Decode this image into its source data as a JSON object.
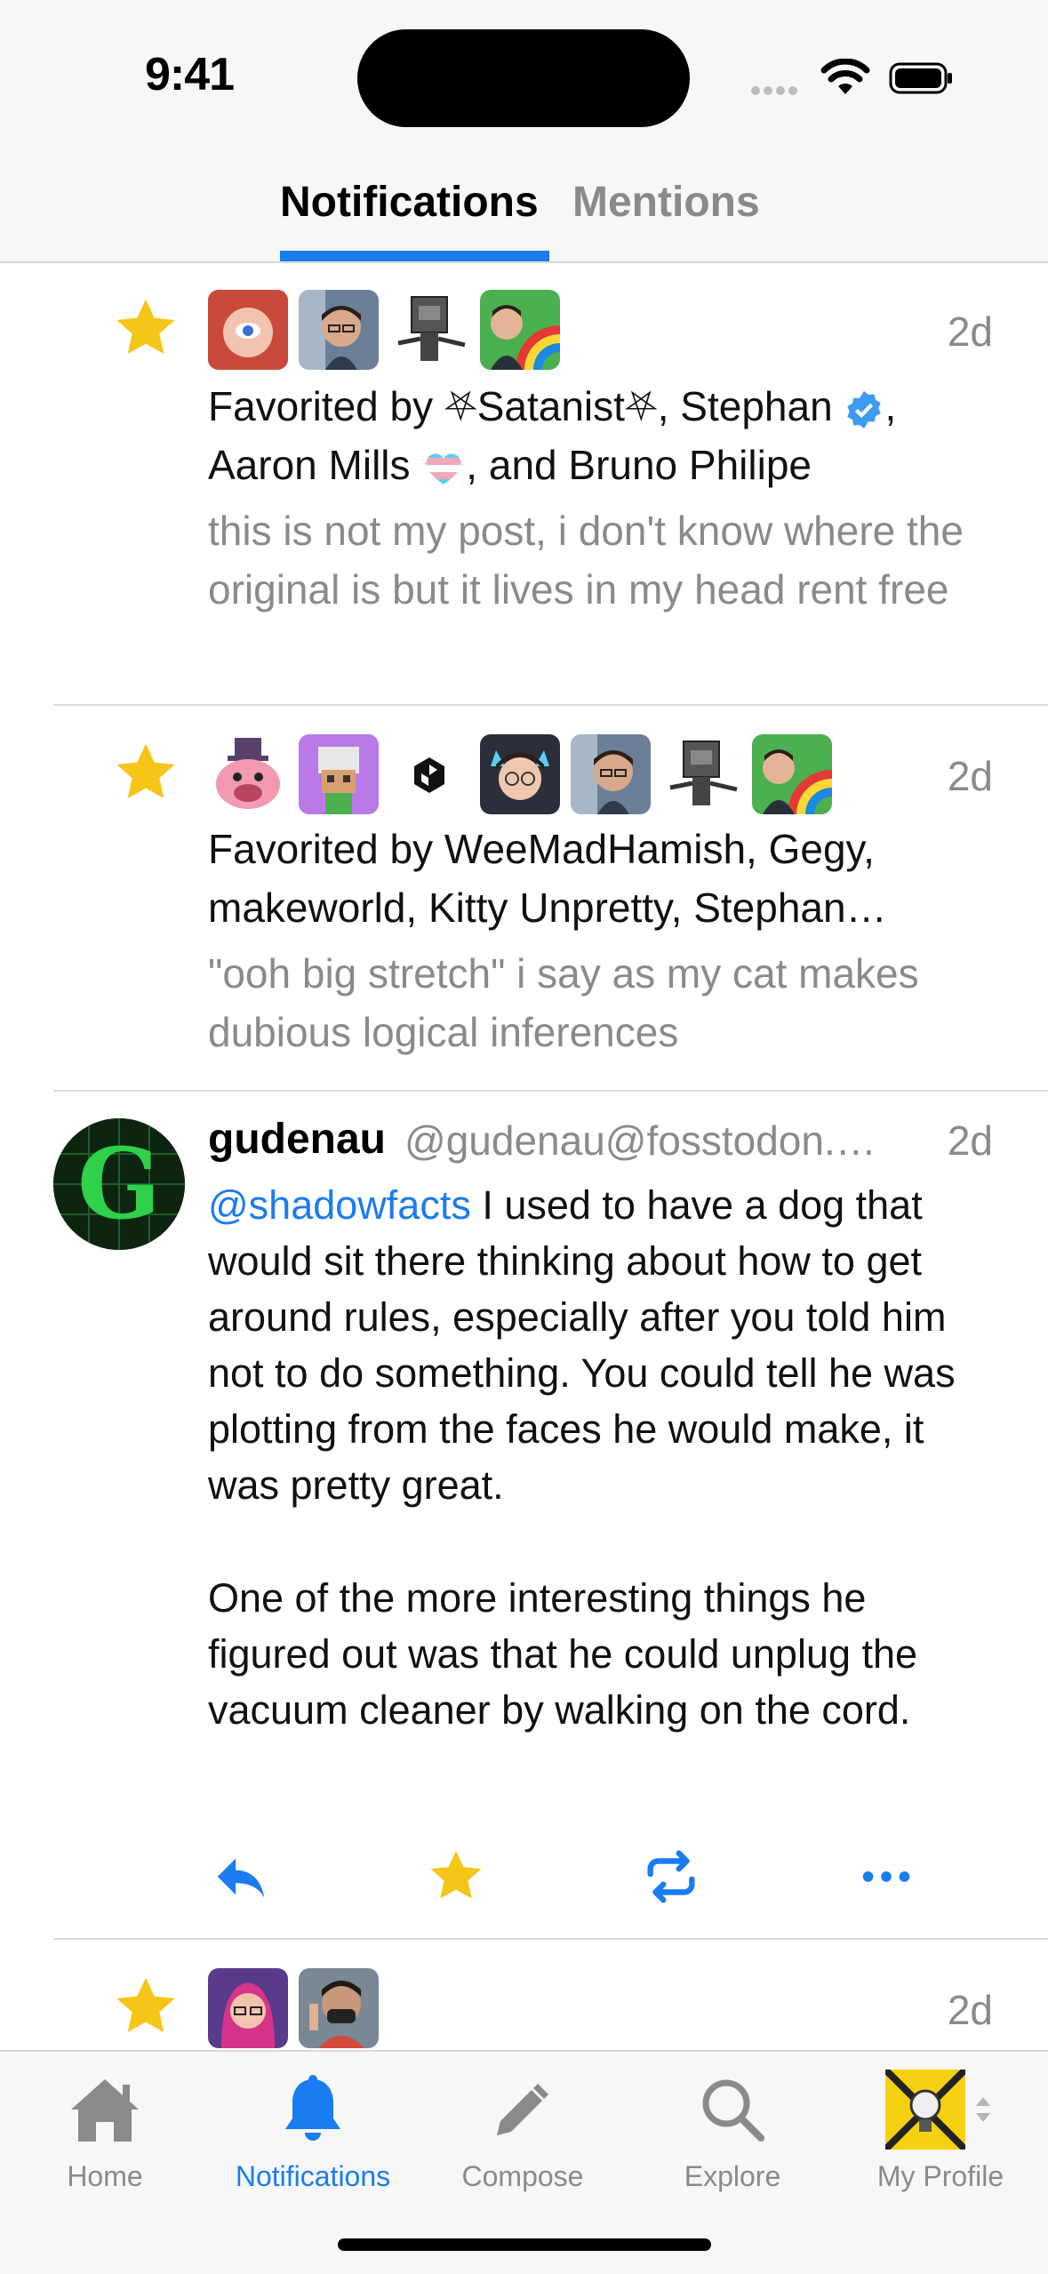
{
  "status": {
    "time": "9:41"
  },
  "tabs": {
    "notifications": "Notifications",
    "mentions": "Mentions"
  },
  "feed": [
    {
      "type": "favorite",
      "time": "2d",
      "title_parts": [
        "Favorited by ",
        "⛧Satanist⛧",
        ", Stephan ",
        ", ",
        "Aaron Mills ",
        ", and Bruno Philipe"
      ],
      "body": "this is not my post, i don't know where the original is but it lives in my head rent free"
    },
    {
      "type": "favorite",
      "time": "2d",
      "title": "Favorited by WeeMadHamish, Gegy, makeworld, Kitty Unpretty, Stephan…",
      "body": "\"ooh big stretch\" i say as my cat makes dubious logical inferences"
    },
    {
      "type": "post",
      "name": "gudenau",
      "handle": "@gudenau@fosstodon.…",
      "time": "2d",
      "mention": "@shadowfacts",
      "text1": " I used to have a dog that would sit there thinking about how to get around rules, especially after you told him not to do something. You could tell he was plotting from the faces he would make, it was pretty great.",
      "text2": "One of the more interesting things he figured out was that he could unplug the vacuum cleaner by walking on the cord."
    },
    {
      "type": "favorite",
      "time": "2d"
    }
  ],
  "tabbar": {
    "home": "Home",
    "notifications": "Notifications",
    "compose": "Compose",
    "explore": "Explore",
    "profile": "My Profile"
  },
  "colors": {
    "accent": "#1a7cf0",
    "star": "#f5c518",
    "secondary": "#8a8a8a"
  }
}
